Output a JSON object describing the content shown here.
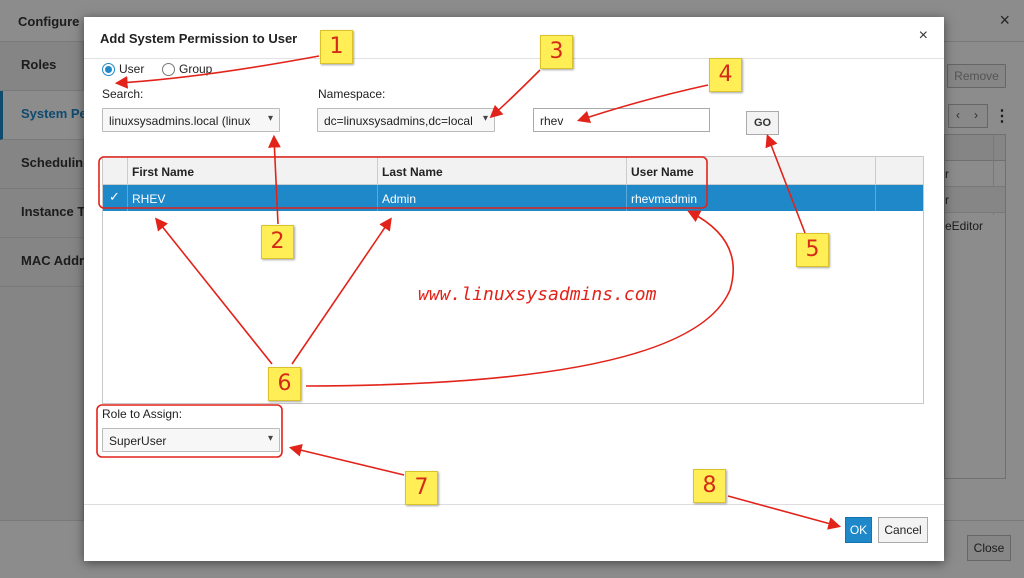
{
  "background_window": {
    "title": "Configure",
    "close_icon": "×",
    "nav_items": [
      "Roles",
      "System Pe",
      "Schedulin",
      "Instance T",
      "MAC Addr"
    ],
    "active_nav_index": 1,
    "remove_label": "Remove",
    "pager_prev": "‹",
    "pager_next": "›",
    "kebab": "⋮",
    "grid_rows": [
      "r",
      "r",
      "eEditor"
    ],
    "close_label": "Close"
  },
  "dialog": {
    "title": "Add System Permission to User",
    "close_icon": "×",
    "radio_user": "User",
    "radio_group": "Group",
    "search_label": "Search:",
    "search_select": "linuxsysadmins.local (linux",
    "namespace_label": "Namespace:",
    "namespace_select": "dc=linuxsysadmins,dc=local",
    "search_text": "rhev",
    "go_label": "GO",
    "table": {
      "columns": [
        "First Name",
        "Last Name",
        "User Name"
      ],
      "rows": [
        {
          "first_name": "RHEV",
          "last_name": "Admin",
          "user_name": "rhevmadmin",
          "selected": true
        }
      ]
    },
    "role_label": "Role to Assign:",
    "role_select": "SuperUser",
    "ok_label": "OK",
    "cancel_label": "Cancel"
  },
  "annotations": {
    "callouts": [
      "1",
      "2",
      "3",
      "4",
      "5",
      "6",
      "7",
      "8"
    ],
    "watermark": "www.linuxsysadmins.com"
  },
  "colors": {
    "accent": "#1e88c9",
    "annotation_red": "#e2231a",
    "callout_yellow": "#ffee55"
  },
  "icons": {
    "check": "check-icon",
    "chevron": "chevron-down-icon",
    "close": "close-icon",
    "kebab": "kebab-icon"
  }
}
